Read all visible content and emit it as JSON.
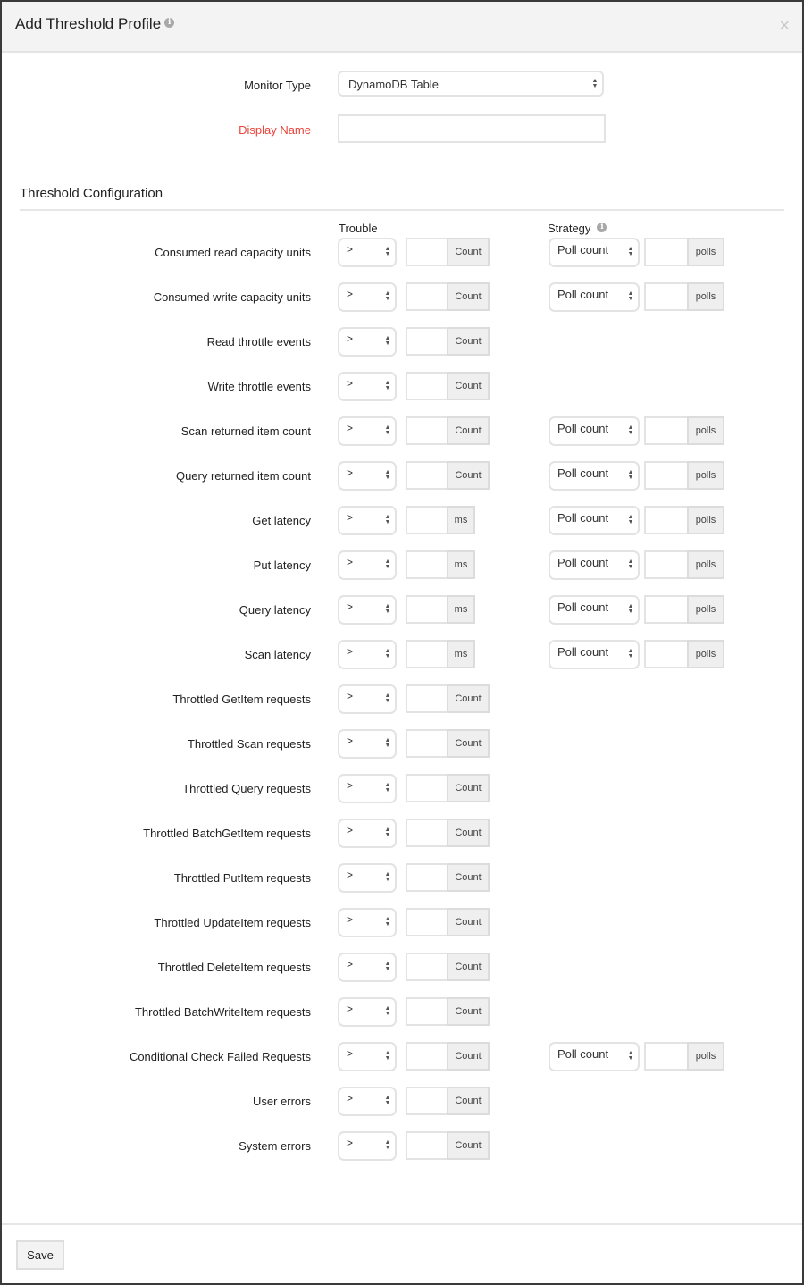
{
  "dialog": {
    "title": "Add Threshold Profile",
    "close_glyph": "×",
    "info_glyph": "i"
  },
  "form": {
    "monitor_type_label": "Monitor Type",
    "monitor_type_value": "DynamoDB Table",
    "display_name_label": "Display Name",
    "display_name_value": ""
  },
  "threshold": {
    "section_title": "Threshold Configuration",
    "trouble_header": "Trouble",
    "strategy_header": "Strategy",
    "rows": [
      {
        "label": "Consumed read capacity units",
        "operator": ">",
        "unit": "Count",
        "strategy": "Poll count",
        "strategy_unit": "polls"
      },
      {
        "label": "Consumed write capacity units",
        "operator": ">",
        "unit": "Count",
        "strategy": "Poll count",
        "strategy_unit": "polls"
      },
      {
        "label": "Read throttle events",
        "operator": ">",
        "unit": "Count",
        "strategy": null,
        "strategy_unit": null
      },
      {
        "label": "Write throttle events",
        "operator": ">",
        "unit": "Count",
        "strategy": null,
        "strategy_unit": null
      },
      {
        "label": "Scan returned item count",
        "operator": ">",
        "unit": "Count",
        "strategy": "Poll count",
        "strategy_unit": "polls"
      },
      {
        "label": "Query returned item count",
        "operator": ">",
        "unit": "Count",
        "strategy": "Poll count",
        "strategy_unit": "polls"
      },
      {
        "label": "Get latency",
        "operator": ">",
        "unit": "ms",
        "strategy": "Poll count",
        "strategy_unit": "polls"
      },
      {
        "label": "Put latency",
        "operator": ">",
        "unit": "ms",
        "strategy": "Poll count",
        "strategy_unit": "polls"
      },
      {
        "label": "Query latency",
        "operator": ">",
        "unit": "ms",
        "strategy": "Poll count",
        "strategy_unit": "polls"
      },
      {
        "label": "Scan latency",
        "operator": ">",
        "unit": "ms",
        "strategy": "Poll count",
        "strategy_unit": "polls"
      },
      {
        "label": "Throttled GetItem requests",
        "operator": ">",
        "unit": "Count",
        "strategy": null,
        "strategy_unit": null
      },
      {
        "label": "Throttled Scan requests",
        "operator": ">",
        "unit": "Count",
        "strategy": null,
        "strategy_unit": null
      },
      {
        "label": "Throttled Query requests",
        "operator": ">",
        "unit": "Count",
        "strategy": null,
        "strategy_unit": null
      },
      {
        "label": "Throttled BatchGetItem requests",
        "operator": ">",
        "unit": "Count",
        "strategy": null,
        "strategy_unit": null
      },
      {
        "label": "Throttled PutItem requests",
        "operator": ">",
        "unit": "Count",
        "strategy": null,
        "strategy_unit": null
      },
      {
        "label": "Throttled UpdateItem requests",
        "operator": ">",
        "unit": "Count",
        "strategy": null,
        "strategy_unit": null
      },
      {
        "label": "Throttled DeleteItem requests",
        "operator": ">",
        "unit": "Count",
        "strategy": null,
        "strategy_unit": null
      },
      {
        "label": "Throttled BatchWriteItem requests",
        "operator": ">",
        "unit": "Count",
        "strategy": null,
        "strategy_unit": null
      },
      {
        "label": "Conditional Check Failed Requests",
        "operator": ">",
        "unit": "Count",
        "strategy": "Poll count",
        "strategy_unit": "polls"
      },
      {
        "label": "User errors",
        "operator": ">",
        "unit": "Count",
        "strategy": null,
        "strategy_unit": null
      },
      {
        "label": "System errors",
        "operator": ">",
        "unit": "Count",
        "strategy": null,
        "strategy_unit": null
      }
    ]
  },
  "footer": {
    "save_label": "Save"
  },
  "colors": {
    "required_label": "#e8453c",
    "header_bg": "#f3f3f3"
  }
}
